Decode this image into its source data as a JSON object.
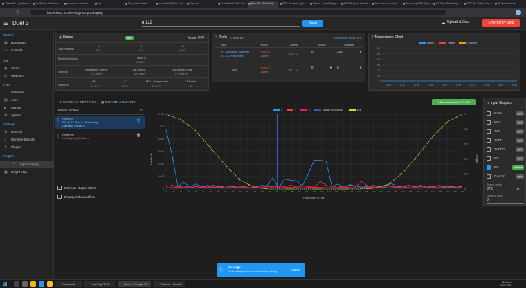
{
  "browser": {
    "tabs": [
      "Video 22 - guidhem...",
      "RatRoot - Custom...",
      "proconext related",
      "rss",
      "3D print related",
      "electric/C6 Duo Rev...",
      "Cop-ss",
      "Prusa/Dual 3.0 - Re...",
      "Duet 3 - Split Brai...",
      "RRF firmware gui...",
      "Home - NinjaStepp...",
      "ZRWS Open Hardw...",
      "Weer thermo and...",
      "Sanmedy E3D Cop...",
      "E3 Sort Bootstrap...",
      "RRF 3 - Build - Dr...",
      "All Bookmarks"
    ],
    "url": "http://duet3.local/#/Plugins/InputShaping"
  },
  "appbar": {
    "title": "Duet 3",
    "code_value": "m122",
    "send_label": "Send",
    "upload_label": "Upload & Start",
    "emergency_label": "Emergency Stop"
  },
  "sidebar": {
    "groups": [
      {
        "label": "Control",
        "items": [
          "Dashboard",
          "Console"
        ]
      },
      {
        "label": "Job",
        "items": [
          "Status",
          "Webcam"
        ]
      },
      {
        "label": "Files",
        "items": [
          "Filaments",
          "Jobs",
          "Macros",
          "System"
        ]
      },
      {
        "label": "Settings",
        "items": [
          "General",
          "Machine-Specific",
          "Plugins"
        ]
      },
      {
        "label": "Plugins",
        "items": [
          "Input Shaping",
          "Height Map"
        ]
      }
    ],
    "selected": "Input Shaping"
  },
  "status": {
    "title": "Status",
    "badge": "Idle",
    "mode": "Mode: FFF",
    "axes": [
      "X",
      "Y",
      "Z"
    ],
    "tool_position_label": "Tool Position",
    "positions": [
      "0.0",
      "0.0",
      "10.00"
    ],
    "extruder_label": "Extruder Drives",
    "drive_label": "Drive 0",
    "drive_value": "20605.9",
    "speeds_label": "Speeds",
    "speed_headers": [
      "Requested Speed",
      "Top Speed",
      "Volumetric Flow"
    ],
    "speed_values": [
      "0.0 mm/s",
      "0.0 mm/s",
      "0.0 mm³/s"
    ],
    "sensors_label": "Sensors",
    "sensor_headers": [
      "Vin",
      "V12",
      "MCU Temperature",
      "Z-Probe"
    ],
    "sensor_values": [
      "23.9 V",
      "12.1 V",
      "45.8 °C",
      "0"
    ]
  },
  "tools": {
    "title": "Tools",
    "control_all": "Control All",
    "extra_link": "CONTROL HEATERS",
    "headers": [
      "Tool",
      "Heater",
      "Current",
      "Active",
      "Standby"
    ],
    "rows": [
      {
        "tool": "T0 - Mosquito Magnum",
        "sub": "T0 - 0.4 Hardened",
        "heater": "Heater 1",
        "heater_state": "active",
        "current": "20.5 °C",
        "active": "0",
        "standby": "230"
      },
      {
        "tool": "Bed",
        "sub": "",
        "heater": "Heater 0",
        "heater_state": "active",
        "current": "40.7 °C",
        "active": "0",
        "standby": "0"
      }
    ]
  },
  "temp_chart": {
    "title": "Temperature Chart",
    "legend": [
      "Heater",
      "Heater",
      "Chamber"
    ],
    "legend_colors": [
      "#2196f3",
      "#f44336",
      "#ff9800"
    ],
    "y_ticks": [
      "300",
      "250",
      "200",
      "150",
      "100",
      "50",
      "0"
    ],
    "x_ticks": [
      "11:30",
      "11:32",
      "11:34",
      "11:36",
      "11:38",
      "11:40",
      "11:42",
      "11:44",
      "11:46",
      "11:48"
    ]
  },
  "tabs": {
    "items": [
      "CURRENT SETTINGS",
      "MOTION ANALYSIS"
    ],
    "active": 1,
    "export_label": "Download Motion Profile"
  },
  "profiles": {
    "header": "Motion Profiles",
    "items": [
      {
        "name": "Profile #1",
        "detail": "EI3 @ 37.5Hz, 0.10 damping",
        "detail2": "Damping Factor: 0",
        "selected": true
      },
      {
        "name": "Profile #0",
        "detail": "No Shaping, 2 Motors",
        "detail2": "",
        "selected": false
      }
    ],
    "estimate_label": "Estimate shaper effect",
    "display_label": "Display individual files"
  },
  "motion_chart": {
    "legend": [
      "X",
      "Y",
      "Z",
      "Shaper Frequency",
      "EI3"
    ],
    "legend_colors": [
      "#2196f3",
      "#f44336",
      "#e91e63",
      "#3f51b5",
      "#cddc39"
    ],
    "y_ticks": [
      "0.012",
      "0.01",
      "0.008",
      "0.006",
      "0.004",
      "0.002",
      "0"
    ],
    "y2_ticks": [
      "1",
      "0.8",
      "0.6",
      "0.4",
      "0.2",
      "0"
    ],
    "ylabel": "Amplitude",
    "y2label": "Shaper",
    "xlabel": "Frequency (in Hz)",
    "x_ticks": [
      "0",
      "5",
      "10",
      "15",
      "20",
      "25",
      "30",
      "35",
      "40",
      "45",
      "50",
      "55",
      "60",
      "65",
      "70",
      "75",
      "80",
      "85",
      "90",
      "95",
      "100",
      "105",
      "110",
      "115",
      "120",
      "125",
      "130",
      "135",
      "140",
      "145",
      "150",
      "155",
      "160",
      "165",
      "170",
      "175",
      "180",
      "185",
      "190",
      "195",
      "200"
    ]
  },
  "chart_data": {
    "type": "line",
    "xlabel": "Frequency (in Hz)",
    "ylabel": "Amplitude",
    "xlim": [
      0,
      200
    ],
    "ylim": [
      0,
      0.012
    ],
    "series": [
      {
        "name": "X",
        "color": "#2196f3",
        "x": [
          0,
          4,
          8,
          12,
          16,
          20,
          24,
          28,
          32,
          36,
          40,
          44,
          48,
          52,
          56,
          60,
          64,
          68,
          72,
          76,
          80,
          84,
          88,
          92,
          96,
          100,
          104,
          108,
          112,
          116,
          120,
          124,
          128,
          132,
          136,
          140,
          144,
          148,
          152,
          156,
          160,
          164,
          168,
          172,
          176,
          180,
          184,
          188,
          192,
          196,
          200
        ],
        "y": [
          0.0095,
          0.0055,
          0.0004,
          0.0011,
          0.0003,
          0.0008,
          0.0004,
          0.0003,
          0.0006,
          0.0003,
          0.0005,
          0.0004,
          0.0003,
          0.0004,
          0.0002,
          0.0003,
          0.0006,
          0.0005,
          0.0018,
          0.0002,
          0.0016,
          0.0014,
          0.0013,
          0.0005,
          0.0024,
          0.0046,
          0.0046,
          0.0045,
          0.0004,
          0.0008,
          0.0003,
          0.0007,
          0.0005,
          0.0003,
          0.0004,
          0.0006,
          0.0004,
          0.0003,
          0.0009,
          0.0004,
          0.0003,
          0.0006,
          0.0004,
          0.0006,
          0.0003,
          0.0004,
          0.0005,
          0.0003,
          0.0004,
          0.0003,
          0.0004
        ]
      },
      {
        "name": "Y",
        "color": "#f44336",
        "x": [
          0,
          4,
          8,
          12,
          16,
          20,
          24,
          28,
          32,
          36,
          40,
          44,
          48,
          52,
          56,
          60,
          64,
          68,
          72,
          76,
          80,
          84,
          88,
          92,
          96,
          100,
          104,
          108,
          112,
          116,
          120,
          124,
          128,
          132,
          136,
          140,
          144,
          148,
          152,
          156,
          160,
          164,
          168,
          172,
          176,
          180,
          184,
          188,
          192,
          196,
          200
        ],
        "y": [
          0.0004,
          0.0006,
          0.0003,
          0.0005,
          0.0002,
          0.0004,
          0.0003,
          0.0006,
          0.0003,
          0.0004,
          0.0002,
          0.0005,
          0.0003,
          0.0004,
          0.0006,
          0.0003,
          0.0005,
          0.0004,
          0.0003,
          0.0005,
          0.0004,
          0.0006,
          0.0003,
          0.0005,
          0.0004,
          0.0003,
          0.0012,
          0.0006,
          0.0004,
          0.0005,
          0.0003,
          0.0006,
          0.0004,
          0.0012,
          0.0005,
          0.0003,
          0.0004,
          0.0006,
          0.0004,
          0.0003,
          0.0005,
          0.0006,
          0.0003,
          0.0004,
          0.0005,
          0.0003,
          0.0006,
          0.0004,
          0.0003,
          0.0005,
          0.0004
        ]
      },
      {
        "name": "Z",
        "color": "#e91e63",
        "x": [
          0,
          10,
          20,
          30,
          40,
          50,
          60,
          70,
          80,
          90,
          100,
          110,
          120,
          130,
          140,
          150,
          160,
          170,
          180,
          190,
          200
        ],
        "y": [
          0.0002,
          0.0003,
          0.0002,
          0.0003,
          0.0002,
          0.0003,
          0.0002,
          0.0004,
          0.0003,
          0.0002,
          0.0003,
          0.0002,
          0.0003,
          0.0002,
          0.0003,
          0.0002,
          0.0003,
          0.0002,
          0.0003,
          0.0002,
          0.0003
        ]
      },
      {
        "name": "EI3",
        "color": "#cddc39",
        "axis": "y2",
        "x": [
          0,
          10,
          20,
          30,
          40,
          50,
          60,
          70,
          80,
          90,
          100,
          110,
          120,
          130,
          140,
          150,
          160,
          170,
          180,
          190,
          200
        ],
        "y": [
          1.0,
          0.93,
          0.78,
          0.55,
          0.32,
          0.12,
          0.02,
          0.0,
          0.0,
          0.0,
          0.0,
          0.0,
          0.0,
          0.0,
          0.01,
          0.06,
          0.22,
          0.45,
          0.7,
          0.9,
          1.0
        ]
      }
    ],
    "shaper_frequency": 75
  },
  "input_shapers": {
    "title": "Input Shapers",
    "apply_label": "apply",
    "active_label": "selected",
    "items": [
      {
        "name": "None",
        "checked": false,
        "active": false
      },
      {
        "name": "MZV",
        "checked": false,
        "active": false
      },
      {
        "name": "ZVD",
        "checked": false,
        "active": false
      },
      {
        "name": "ZVDD",
        "checked": false,
        "active": false
      },
      {
        "name": "ZVDDD",
        "checked": false,
        "active": false
      },
      {
        "name": "EI2",
        "checked": false,
        "active": false
      },
      {
        "name": "EI3",
        "checked": true,
        "active": true
      },
      {
        "name": "Custom",
        "checked": false,
        "active": false
      }
    ],
    "freq_label": "Shaper centre",
    "freq_value": "37.5",
    "freq_unit": "Hz",
    "damp_label": "Damping factor",
    "damp_value": "0"
  },
  "toast": {
    "title": "Message",
    "body": "Press backspace to clear and resume printing",
    "action": "Cancel"
  },
  "taskbar": {
    "apps": [
      "Downloads",
      "Duet3 by OEM...",
      "Duet 3 - Google Ch...",
      "Thinkbot - PrusaS..."
    ],
    "time": "11:48 am",
    "date": "25/07/2024"
  }
}
